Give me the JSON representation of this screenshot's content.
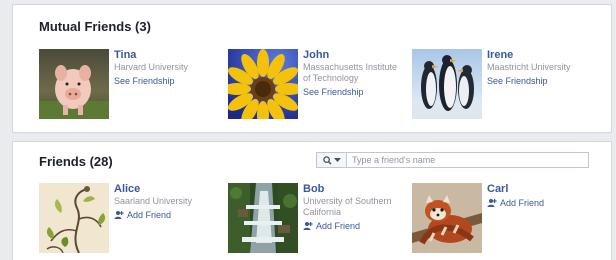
{
  "mutual": {
    "title": "Mutual Friends (3)",
    "people": [
      {
        "name": "Tina",
        "affiliation": "Harvard University",
        "action": "See Friendship",
        "photo_icon": "piglet-photo"
      },
      {
        "name": "John",
        "affiliation": "Massachusetts Institute of Technology",
        "action": "See Friendship",
        "photo_icon": "sunflower-photo"
      },
      {
        "name": "Irene",
        "affiliation": "Maastricht University",
        "action": "See Friendship",
        "photo_icon": "penguins-photo"
      }
    ]
  },
  "friends": {
    "title": "Friends (28)",
    "search": {
      "placeholder": "Type a friend's name",
      "value": ""
    },
    "people": [
      {
        "name": "Alice",
        "affiliation": "Saarland University",
        "action": "Add Friend",
        "photo_icon": "floral-pattern-photo"
      },
      {
        "name": "Bob",
        "affiliation": "University of Southern California",
        "action": "Add Friend",
        "photo_icon": "waterfall-photo"
      },
      {
        "name": "Carl",
        "affiliation": "",
        "action": "Add Friend",
        "photo_icon": "red-panda-photo"
      }
    ]
  },
  "colors": {
    "link": "#3b5998",
    "muted": "#90949c",
    "border": "#d3d6db",
    "background": "#e9ebee"
  }
}
